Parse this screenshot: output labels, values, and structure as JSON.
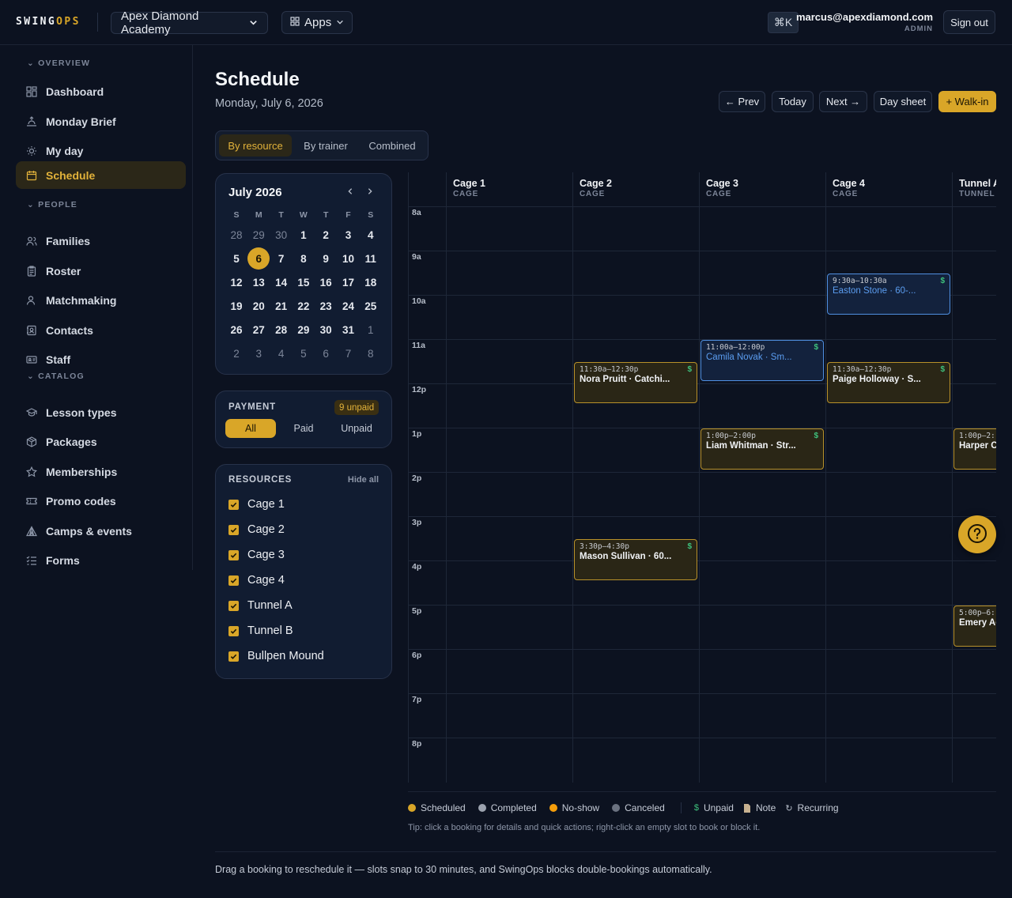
{
  "brand": {
    "name_a": "SWING",
    "name_b": "OPS",
    "accent": "#d9a628"
  },
  "topbar": {
    "org": "Apex Diamond Academy",
    "apps": "Apps",
    "shortcut": "⌘K",
    "email": "marcus@apexdiamond.com",
    "role": "ADMIN",
    "signout": "Sign out"
  },
  "sidebar": {
    "overview": "OVERVIEW",
    "people": "PEOPLE",
    "catalog": "CATALOG",
    "items": [
      {
        "label": "Dashboard",
        "icon": "dashboard-icon"
      },
      {
        "label": "Monday Brief",
        "icon": "sunrise-icon"
      },
      {
        "label": "My day",
        "icon": "sun-icon"
      },
      {
        "label": "Schedule",
        "icon": "calendar-icon",
        "active": true
      },
      {
        "label": "Families",
        "icon": "users-icon"
      },
      {
        "label": "Roster",
        "icon": "clipboard-icon"
      },
      {
        "label": "Matchmaking",
        "icon": "user-match-icon"
      },
      {
        "label": "Contacts",
        "icon": "contacts-icon"
      },
      {
        "label": "Staff",
        "icon": "id-card-icon"
      },
      {
        "label": "Lesson types",
        "icon": "graduation-icon"
      },
      {
        "label": "Packages",
        "icon": "package-icon"
      },
      {
        "label": "Memberships",
        "icon": "star-icon"
      },
      {
        "label": "Promo codes",
        "icon": "ticket-icon"
      },
      {
        "label": "Camps & events",
        "icon": "tent-icon"
      },
      {
        "label": "Forms",
        "icon": "list-check-icon"
      }
    ]
  },
  "header": {
    "title": "Schedule",
    "date": "Monday, July 6, 2026",
    "prev": "← Prev",
    "today": "Today",
    "next": "Next →",
    "day_sheet": "Day sheet",
    "walk_in": "+ Walk-in"
  },
  "view_tabs": [
    "By resource",
    "By trainer",
    "Combined"
  ],
  "calendar": {
    "month": "July 2026",
    "dow": [
      "S",
      "M",
      "T",
      "W",
      "T",
      "F",
      "S"
    ],
    "weeks": [
      [
        "28",
        "29",
        "30",
        "1",
        "2",
        "3",
        "4"
      ],
      [
        "5",
        "6",
        "7",
        "8",
        "9",
        "10",
        "11"
      ],
      [
        "12",
        "13",
        "14",
        "15",
        "16",
        "17",
        "18"
      ],
      [
        "19",
        "20",
        "21",
        "22",
        "23",
        "24",
        "25"
      ],
      [
        "26",
        "27",
        "28",
        "29",
        "30",
        "31",
        "1"
      ],
      [
        "2",
        "3",
        "4",
        "5",
        "6",
        "7",
        "8"
      ]
    ],
    "selected": "6"
  },
  "payment": {
    "label": "PAYMENT",
    "badge": "9 unpaid",
    "options": [
      "All",
      "Paid",
      "Unpaid"
    ],
    "selected": "All"
  },
  "resources": {
    "label": "RESOURCES",
    "hide_all": "Hide all",
    "items": [
      "Cage 1",
      "Cage 2",
      "Cage 3",
      "Cage 4",
      "Tunnel A",
      "Tunnel B",
      "Bullpen Mound"
    ]
  },
  "grid": {
    "columns": [
      {
        "name": "Cage 1",
        "type": "CAGE"
      },
      {
        "name": "Cage 2",
        "type": "CAGE"
      },
      {
        "name": "Cage 3",
        "type": "CAGE"
      },
      {
        "name": "Cage 4",
        "type": "CAGE"
      },
      {
        "name": "Tunnel A",
        "type": "TUNNEL"
      }
    ],
    "hours": [
      "8a",
      "9a",
      "10a",
      "11a",
      "12p",
      "1p",
      "2p",
      "3p",
      "4p",
      "5p",
      "6p",
      "7p",
      "8p"
    ],
    "bookings": [
      {
        "col": 3,
        "start": 9.5,
        "time": "9:30a–10:30a",
        "name": "Easton Stone · 60-...",
        "style": "blue",
        "unpaid": true
      },
      {
        "col": 2,
        "start": 11,
        "time": "11:00a–12:00p",
        "name": "Camila Novak · Sm...",
        "style": "blue",
        "unpaid": true
      },
      {
        "col": 1,
        "start": 11.5,
        "time": "11:30a–12:30p",
        "name": "Nora Pruitt · Catchi...",
        "style": "gold",
        "unpaid": true
      },
      {
        "col": 3,
        "start": 11.5,
        "time": "11:30a–12:30p",
        "name": "Paige Holloway · S...",
        "style": "gold",
        "unpaid": true
      },
      {
        "col": 2,
        "start": 13,
        "time": "1:00p–2:00p",
        "name": "Liam Whitman · Str...",
        "style": "gold",
        "unpaid": true
      },
      {
        "col": 4,
        "start": 13,
        "time": "1:00p–2:",
        "name": "Harper C",
        "style": "gold",
        "unpaid": false
      },
      {
        "col": 1,
        "start": 15.5,
        "time": "3:30p–4:30p",
        "name": "Mason Sullivan · 60...",
        "style": "gold",
        "unpaid": true
      },
      {
        "col": 4,
        "start": 17,
        "time": "5:00p–6:",
        "name": "Emery Ac",
        "style": "gold",
        "unpaid": false
      }
    ]
  },
  "legend": [
    {
      "label": "Scheduled",
      "color": "#d9a628"
    },
    {
      "label": "Completed",
      "color": "#9ca3af"
    },
    {
      "label": "No-show",
      "color": "#f59e0b"
    },
    {
      "label": "Canceled",
      "color": "#6b7280"
    }
  ],
  "legend_marks": [
    {
      "glyph": "$",
      "label": "Unpaid"
    },
    {
      "glyph": "📄",
      "label": "Note"
    },
    {
      "glyph": "↻",
      "label": "Recurring"
    }
  ],
  "tip": "Tip: click a booking for details and quick actions; right-click an empty slot to book or block it.",
  "footer": "Drag a booking to reschedule it — slots snap to 30 minutes, and SwingOps blocks double-bookings automatically."
}
